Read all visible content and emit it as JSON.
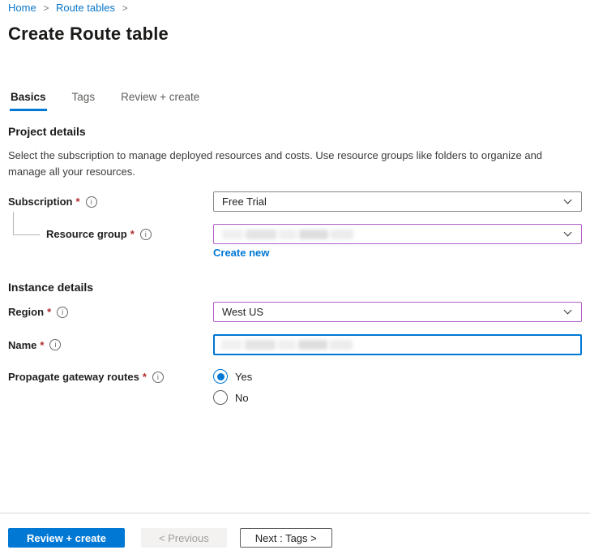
{
  "breadcrumb": {
    "items": [
      {
        "label": "Home"
      },
      {
        "label": "Route tables"
      }
    ],
    "separator": ">"
  },
  "page": {
    "title": "Create Route table"
  },
  "tabs": [
    {
      "label": "Basics",
      "active": true
    },
    {
      "label": "Tags",
      "active": false
    },
    {
      "label": "Review + create",
      "active": false
    }
  ],
  "sections": {
    "project": {
      "heading": "Project details",
      "description": "Select the subscription to manage deployed resources and costs. Use resource groups like folders to organize and manage all your resources."
    },
    "instance": {
      "heading": "Instance details"
    }
  },
  "fields": {
    "subscription": {
      "label": "Subscription",
      "required": "*",
      "value": "Free Trial"
    },
    "resource_group": {
      "label": "Resource group",
      "required": "*",
      "value": "",
      "value_redacted": true,
      "create_new_label": "Create new"
    },
    "region": {
      "label": "Region",
      "required": "*",
      "value": "West US"
    },
    "name": {
      "label": "Name",
      "required": "*",
      "value": "",
      "value_redacted": true
    },
    "propagate": {
      "label": "Propagate gateway routes",
      "required": "*",
      "options": [
        {
          "label": "Yes",
          "selected": true
        },
        {
          "label": "No",
          "selected": false
        }
      ]
    }
  },
  "icons": {
    "info_glyph": "i"
  },
  "footer": {
    "review_create_label": "Review + create",
    "previous_label": "< Previous",
    "next_label": "Next : Tags >"
  },
  "colors": {
    "accent_blue": "#0078d4",
    "link_blue": "#0a77c9",
    "purple_border": "#b061c9",
    "required_red": "#b02b2b",
    "disabled_text": "#a19f9d"
  }
}
